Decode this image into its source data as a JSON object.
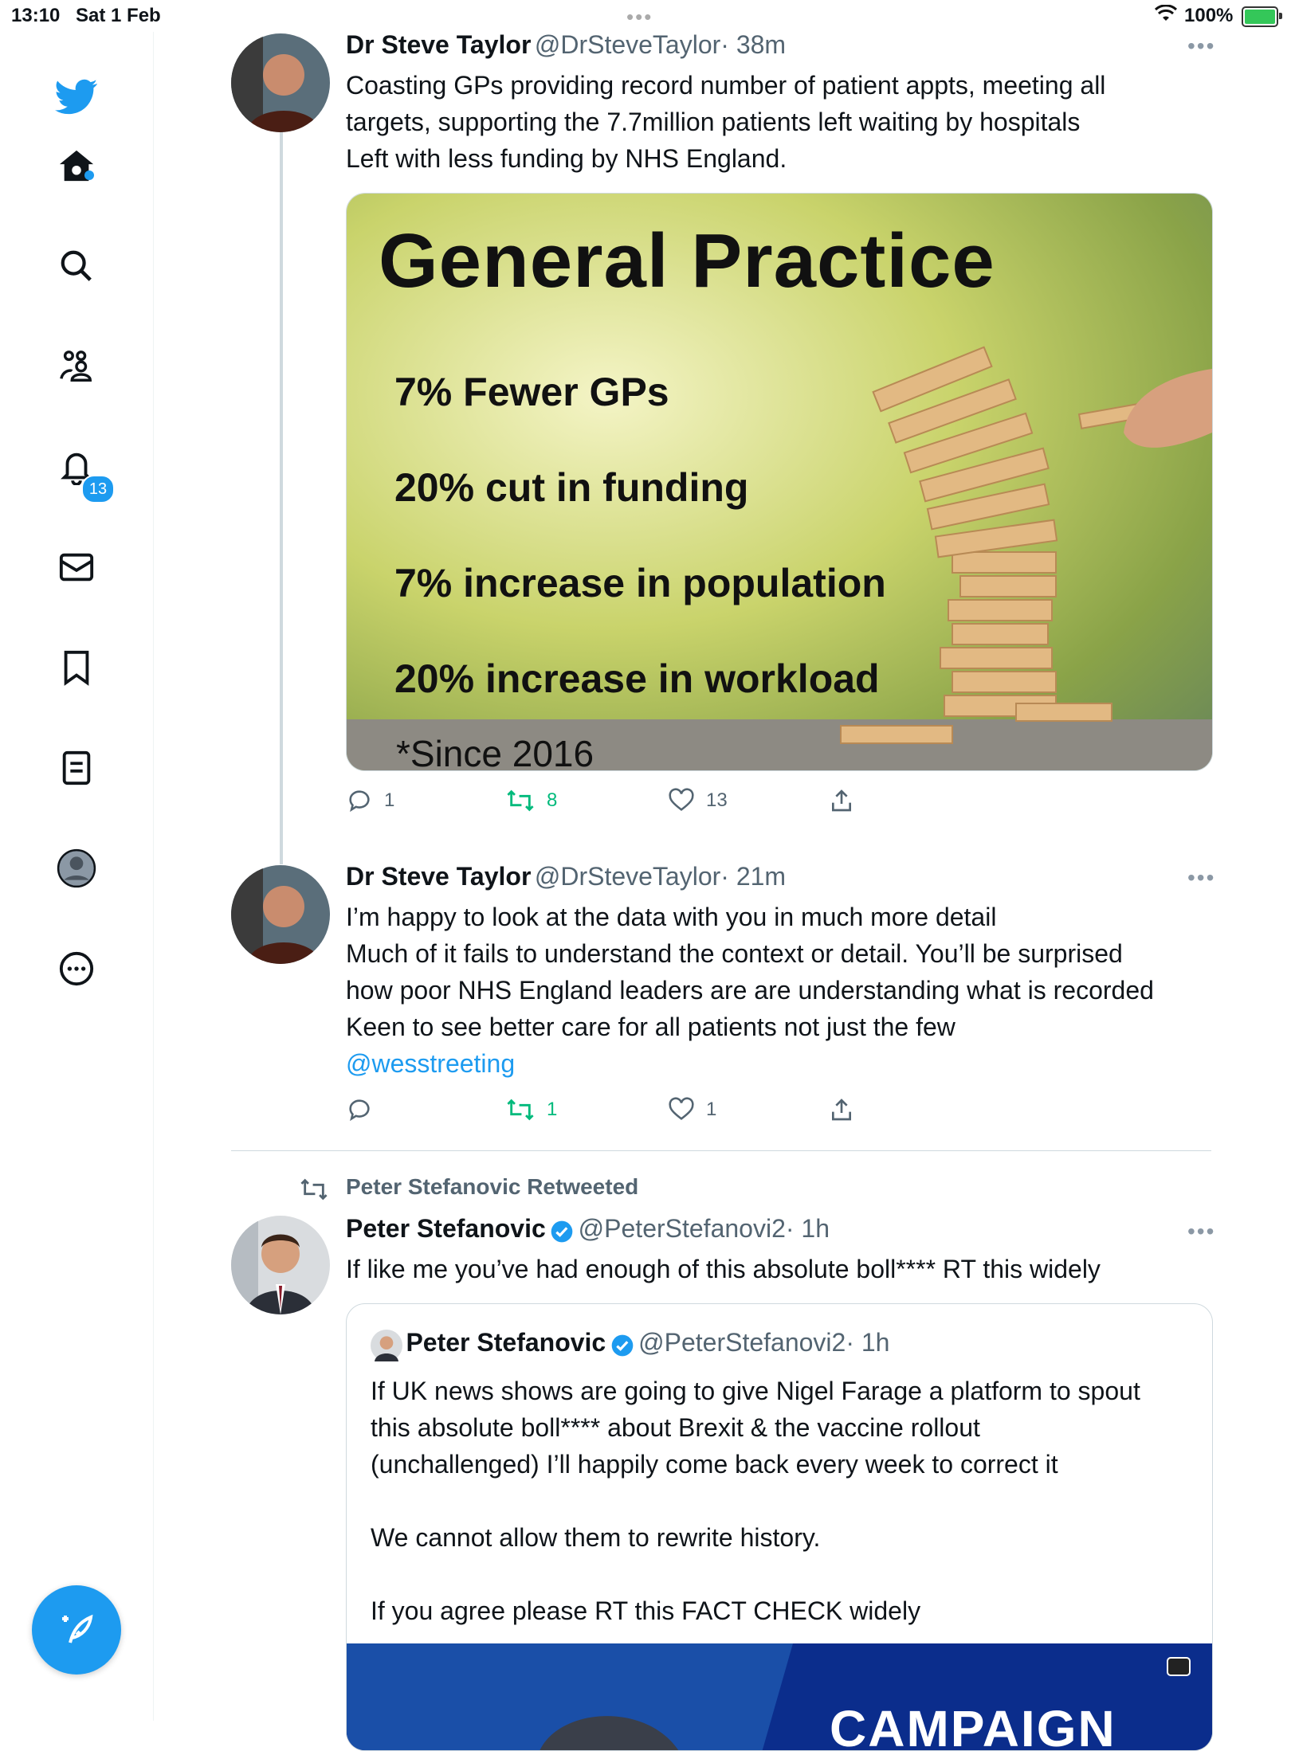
{
  "status_bar": {
    "time": "13:10",
    "date": "Sat 1 Feb",
    "battery": "100%"
  },
  "sidebar": {
    "notifications_badge": "13",
    "items": [
      "twitter-logo",
      "home",
      "search",
      "communities",
      "notifications",
      "messages",
      "bookmarks",
      "lists",
      "profile",
      "more"
    ]
  },
  "tweets": [
    {
      "name": "Dr Steve Taylor",
      "handle": "@DrSteveTaylor",
      "time": "· 38m",
      "lines": [
        "Coasting GPs providing record number of patient appts, meeting all",
        "targets, supporting the 7.7million patients left waiting by hospitals",
        "Left with less funding by NHS England."
      ],
      "media": {
        "title": "General Practice",
        "bullets": [
          "7% Fewer GPs",
          "20% cut in funding",
          "7% increase in population",
          "20% increase in workload"
        ],
        "footnote": "*Since 2016"
      },
      "stats": {
        "replies": "1",
        "retweets": "8",
        "likes": "13"
      }
    },
    {
      "name": "Dr Steve Taylor",
      "handle": "@DrSteveTaylor",
      "time": "· 21m",
      "lines": [
        "I’m happy to look at the data with you in much more detail",
        "Much of it fails to understand the context or detail. You’ll be surprised",
        "how poor NHS England leaders are are understanding what is recorded",
        "Keen to see better care for all patients not just the few"
      ],
      "mention": "@wesstreeting",
      "stats": {
        "replies": "",
        "retweets": "1",
        "likes": "1"
      }
    },
    {
      "retweeted_by": "Peter Stefanovic Retweeted",
      "name": "Peter Stefanovic",
      "handle": "@PeterStefanovi2",
      "time": "· 1h",
      "text": "If like me you’ve had enough of this absolute boll**** RT this widely",
      "quote": {
        "name": "Peter Stefanovic",
        "handle": "@PeterStefanovi2",
        "time": "· 1h",
        "lines": [
          "If UK news shows are going to give Nigel Farage a platform to spout",
          "this absolute boll**** about Brexit & the vaccine rollout",
          "(unchallenged) I’ll happily come back every week to correct it",
          "",
          "We cannot allow them to rewrite history.",
          "",
          "If you agree please RT this FACT CHECK widely"
        ],
        "video_caption": "CAMPAIGN"
      }
    }
  ]
}
